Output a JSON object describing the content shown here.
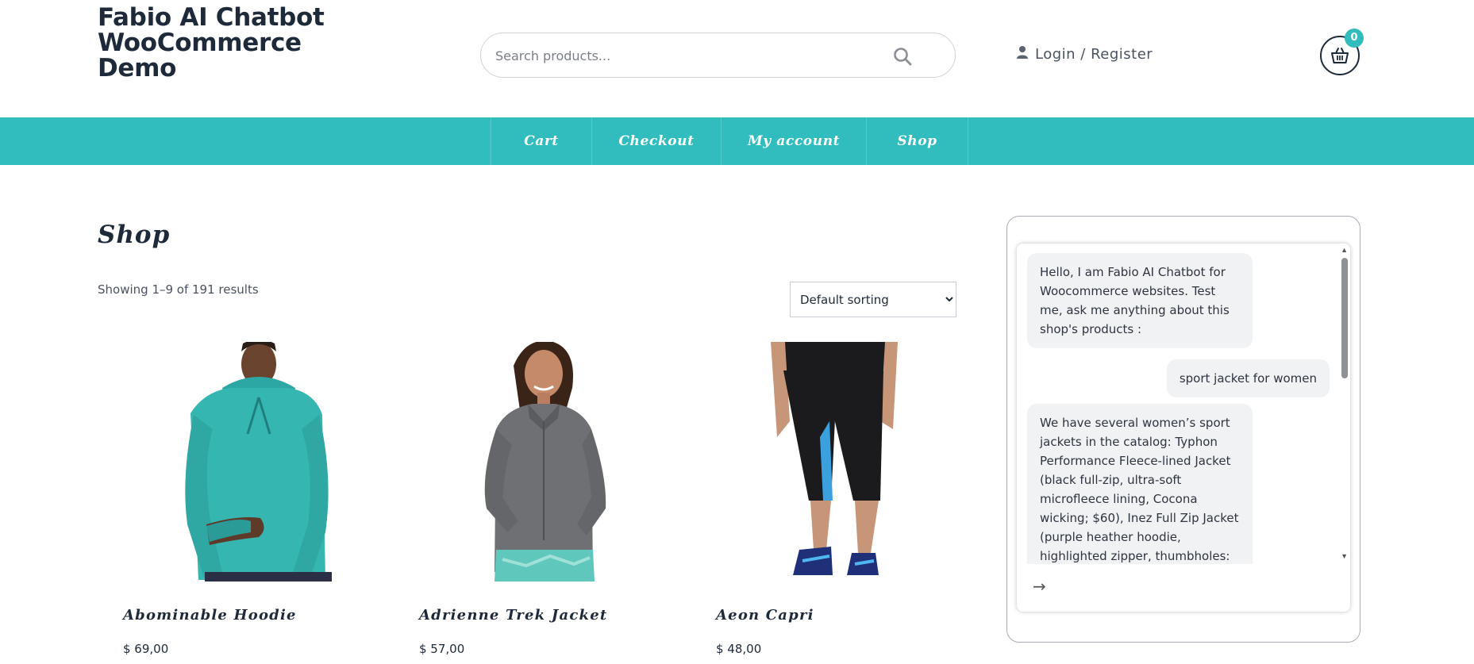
{
  "header": {
    "site_title": "Fabio AI Chatbot WooCommerce Demo",
    "search_placeholder": "Search products...",
    "login_label": "Login / Register",
    "cart_count": "0"
  },
  "nav": {
    "items": [
      {
        "label": "Cart"
      },
      {
        "label": "Checkout"
      },
      {
        "label": "My account"
      },
      {
        "label": "Shop"
      }
    ]
  },
  "main": {
    "title": "Shop",
    "result_count": "Showing 1–9 of 191 results",
    "sort_selected": "Default sorting"
  },
  "products": [
    {
      "name": "Abominable Hoodie",
      "price": "$ 69,00",
      "image": "man-teal-hoodie"
    },
    {
      "name": "Adrienne Trek Jacket",
      "price": "$ 57,00",
      "image": "woman-gray-jacket"
    },
    {
      "name": "Aeon Capri",
      "price": "$ 48,00",
      "image": "black-capri-leggings"
    }
  ],
  "chat": {
    "messages": [
      {
        "role": "bot",
        "text": "Hello, I am Fabio AI Chatbot for Woocommerce websites. Test me, ask me anything about this shop's products :"
      },
      {
        "role": "user",
        "text": "sport jacket for women"
      },
      {
        "role": "bot",
        "text": "We have several women’s sport jackets in the catalog: Typhon Performance Fleece-lined Jacket (black full-zip, ultra-soft microfleece lining, Cocona wicking; $60), Inez Full Zip Jacket (purple heather hoodie, highlighted zipper, thumbholes:"
      }
    ],
    "send_icon": "arrow-right-icon"
  },
  "colors": {
    "accent": "#31bcbe",
    "dark": "#1e2a3a",
    "bubble": "#f1f2f4"
  }
}
